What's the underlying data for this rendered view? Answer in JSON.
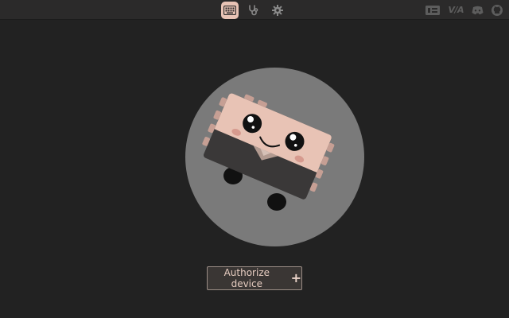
{
  "topbar": {
    "nav": [
      {
        "name": "keyboard",
        "icon": "keyboard-icon",
        "active": true
      },
      {
        "name": "debug",
        "icon": "stethoscope-icon",
        "active": false
      },
      {
        "name": "settings",
        "icon": "gear-icon",
        "active": false
      }
    ],
    "right": [
      {
        "name": "keyboard-layout",
        "icon": "keyboard-layout-icon"
      },
      {
        "name": "via",
        "label": "V/A"
      },
      {
        "name": "discord",
        "icon": "discord-icon"
      },
      {
        "name": "github",
        "icon": "github-icon"
      }
    ]
  },
  "main": {
    "authorize_label": "Authorize device",
    "authorize_icon": "plus-icon"
  },
  "colors": {
    "background": "#222222",
    "accent": "#e8c3b5",
    "circle": "#7a7a7a"
  }
}
